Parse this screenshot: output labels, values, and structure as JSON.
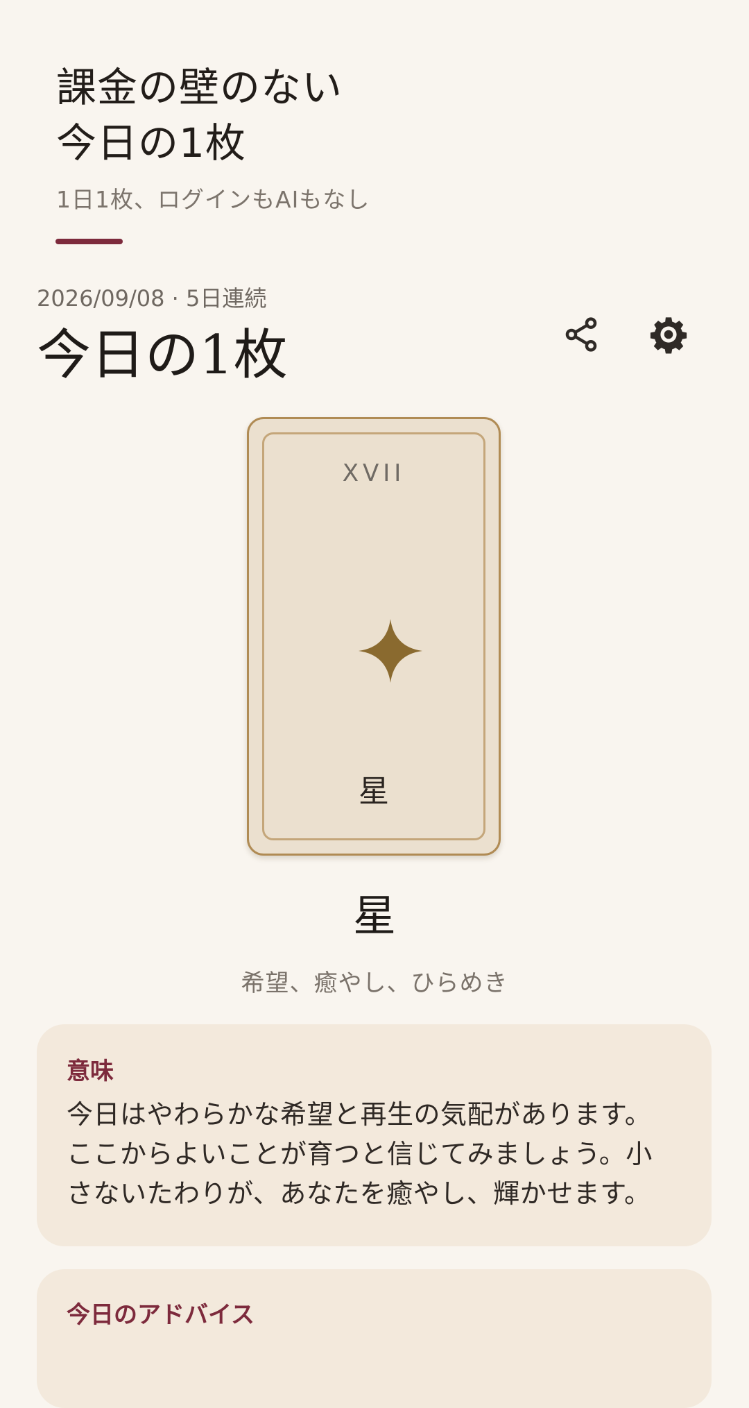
{
  "promo": {
    "title_line1": "課金の壁のない",
    "title_line2": "今日の1枚",
    "subtitle": "1日1枚、ログインもAIもなし",
    "accent_color": "#7d2a3c"
  },
  "header": {
    "meta": "2026/09/08 · 5日連続",
    "title": "今日の1枚",
    "share_icon": "share-icon",
    "settings_icon": "gear-icon"
  },
  "card": {
    "numeral": "XVII",
    "symbol": "four-point-star",
    "name_on_card": "星",
    "name": "星",
    "keywords": "希望、癒やし、ひらめき",
    "frame_color": "#b08b54",
    "symbol_color": "#8a6a2f"
  },
  "meaning": {
    "label": "意味",
    "text_line1": "今日はやわらかな希望と再生の気配があります。",
    "text_line2": "ここからよいことが育つと信じてみましょう。小",
    "text_line3": "さないたわりが、あなたを癒やし、輝かせます。"
  },
  "advice": {
    "label": "今日のアドバイス"
  }
}
